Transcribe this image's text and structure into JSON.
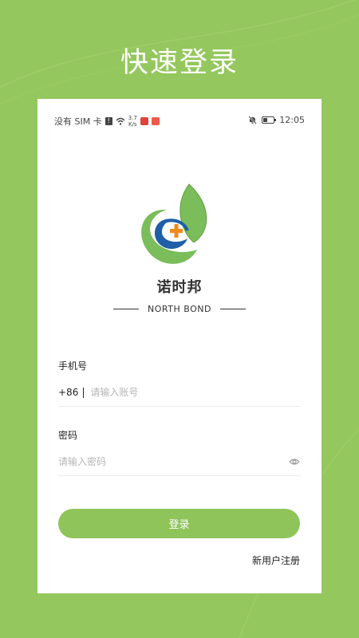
{
  "hero_title": "快速登录",
  "statusbar": {
    "carrier": "没有 SIM 卡",
    "sim_badge": "!",
    "speed_value": "3.7",
    "speed_unit": "K/s",
    "time": "12:05",
    "battery_fill": 0.4
  },
  "brand": {
    "name_cn": "诺时邦",
    "name_en": "NORTH BOND"
  },
  "form": {
    "phone_label": "手机号",
    "phone_prefix": "+86",
    "phone_placeholder": "请输入账号",
    "password_label": "密码",
    "password_placeholder": "请输入密码"
  },
  "actions": {
    "login_label": "登录",
    "register_label": "新用户注册"
  },
  "colors": {
    "background": "#94c75d",
    "primary": "#8fc45a",
    "logo_green": "#7bbd5a",
    "logo_blue": "#1f5fa8",
    "logo_orange": "#f08a1c"
  }
}
